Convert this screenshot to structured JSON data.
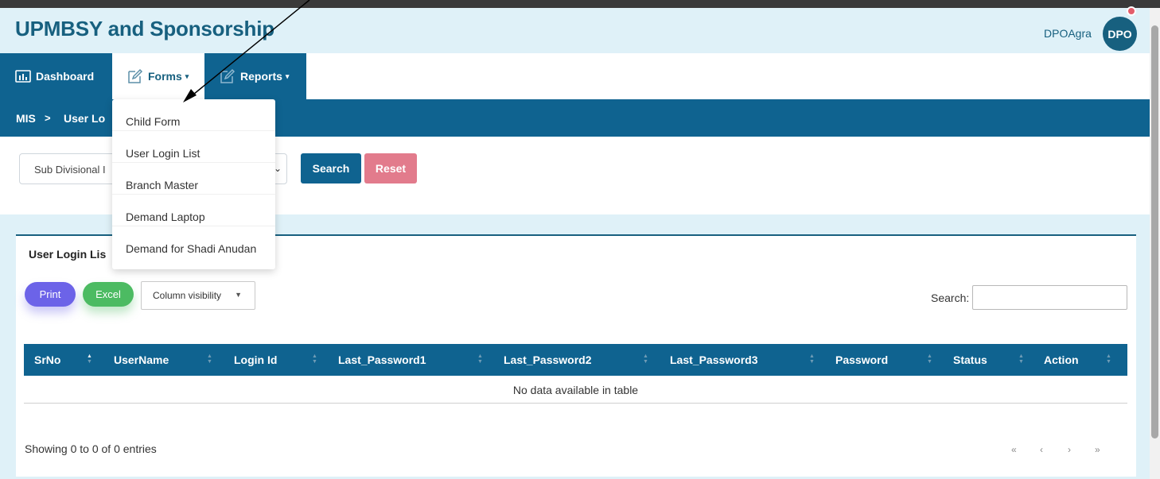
{
  "app": {
    "title": "UPMBSY and Sponsorship"
  },
  "user": {
    "name": "DPOAgra",
    "avatar_initials": "DPO"
  },
  "nav": {
    "dashboard": "Dashboard",
    "forms": "Forms",
    "reports": "Reports"
  },
  "forms_menu": {
    "items": [
      "Child Form",
      "User Login List",
      "Branch Master",
      "Demand Laptop",
      "Demand for Shadi Anudan"
    ]
  },
  "breadcrumb": {
    "root": "MIS",
    "separator": ">",
    "current": "User Lo"
  },
  "filter": {
    "select_value": "Sub Divisional I",
    "search_label": "Search",
    "reset_label": "Reset"
  },
  "card": {
    "title": "User Login Lis"
  },
  "buttons": {
    "print": "Print",
    "excel": "Excel",
    "column_visibility": "Column visibility"
  },
  "table": {
    "search_label": "Search:",
    "columns": [
      "SrNo",
      "UserName",
      "Login Id",
      "Last_Password1",
      "Last_Password2",
      "Last_Password3",
      "Password",
      "Status",
      "Action"
    ],
    "empty_message": "No data available in table",
    "info": "Showing 0 to 0 of 0 entries"
  },
  "pagination": {
    "first": "«",
    "prev": "‹",
    "next": "›",
    "last": "»"
  },
  "colors": {
    "brand": "#17607f",
    "nav_bg": "#0f6390",
    "header_bg": "#dff1f8",
    "print": "#6c63e8",
    "excel": "#4cbb62",
    "reset": "#e27b8c",
    "notification_dot": "#e35d6a"
  }
}
